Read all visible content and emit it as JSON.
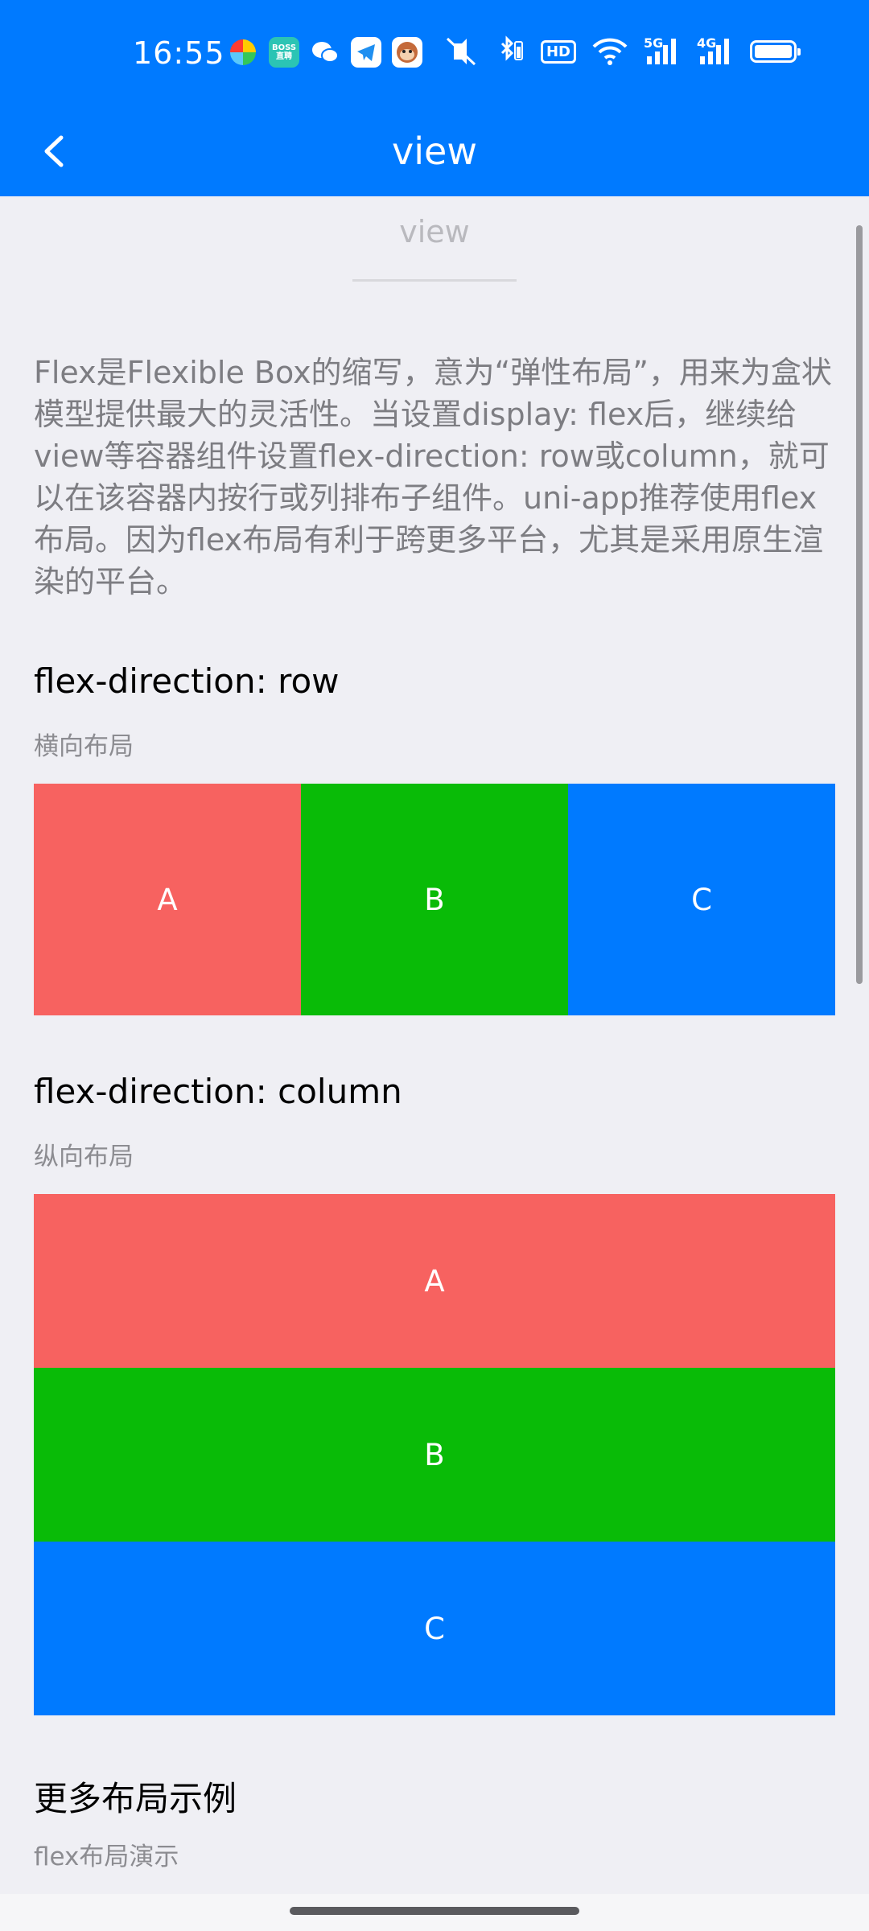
{
  "status_bar": {
    "time": "16:55",
    "app_icons": [
      {
        "name": "pinwheel-app-icon",
        "label": "",
        "color": "#ffffff"
      },
      {
        "name": "boss-zhipin-app-icon",
        "label": "BOSS直聘",
        "color": "#2bc4b4"
      },
      {
        "name": "wechat-app-icon",
        "label": "",
        "color": "#ffffff"
      },
      {
        "name": "telegram-app-icon",
        "label": "",
        "color": "#ffffff"
      },
      {
        "name": "monkey-app-icon",
        "label": "",
        "color": "#ffffff"
      }
    ],
    "hd_label": "HD",
    "signal_1_label": "5G",
    "signal_2_label": "4G"
  },
  "nav": {
    "title": "view"
  },
  "page": {
    "subtitle": "view",
    "description": "Flex是Flexible Box的缩写，意为“弹性布局”，用来为盒状模型提供最大的灵活性。当设置display: flex后，继续给view等容器组件设置flex-direction: row或column，就可以在该容器内按行或列排布子组件。uni-app推荐使用flex布局。因为flex布局有利于跨更多平台，尤其是采用原生渲染的平台。",
    "row_section": {
      "title": "flex-direction: row",
      "subtitle": "横向布局",
      "cells": [
        "A",
        "B",
        "C"
      ]
    },
    "column_section": {
      "title": "flex-direction: column",
      "subtitle": "纵向布局",
      "cells": [
        "A",
        "B",
        "C"
      ]
    },
    "more_section": {
      "title": "更多布局示例",
      "subtitle": "flex布局演示"
    }
  },
  "colors": {
    "primary": "#007aff",
    "red": "#f76260",
    "green": "#09bb07",
    "blue": "#007aff",
    "background": "#efeff4"
  }
}
